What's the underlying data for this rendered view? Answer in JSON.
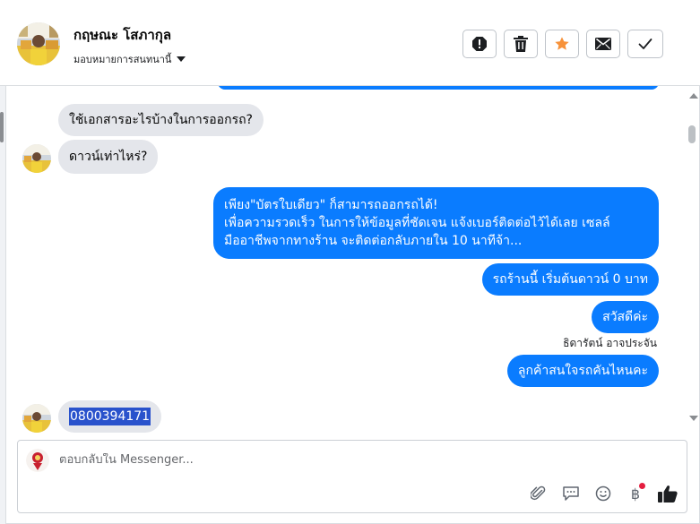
{
  "header": {
    "contact_name": "กฤษณะ โสภากุล",
    "assign_label": "มอบหมายการสนทนานี้",
    "actions": [
      {
        "name": "report-icon"
      },
      {
        "name": "trash-icon"
      },
      {
        "name": "star-icon",
        "color": "#f7923a"
      },
      {
        "name": "envelope-icon"
      },
      {
        "name": "checkmark-icon"
      }
    ]
  },
  "messages": [
    {
      "id": "m1",
      "dir": "in",
      "text": "ใช้เอกสารอะไรบ้างในการออกรถ?"
    },
    {
      "id": "m2",
      "dir": "in",
      "text": "ดาวน์เท่าไหร่?"
    },
    {
      "id": "m3",
      "dir": "out",
      "text": "เพียง\"บัตรใบเดียว\" ก็สามารถออกรถได้!\nเพื่อความรวดเร็ว ในการให้ข้อมูลที่ชัดเจน แจ้งเบอร์ติดต่อไว้ได้เลย เซลล์\nมืออาชีพจากทางร้าน จะติดต่อกลับภายใน 10 นาทีจ้า..."
    },
    {
      "id": "m4",
      "dir": "out",
      "text": "รถร้านนี้ เริ่มต้นดาวน์ 0 บาท"
    },
    {
      "id": "m5",
      "dir": "out",
      "text": "สวัสดีค่ะ"
    },
    {
      "id": "m6",
      "dir": "out",
      "text": "ลูกค้าสนใจรถคันไหนคะ"
    },
    {
      "id": "m7",
      "dir": "in",
      "text": "0800394171"
    }
  ],
  "sender_label": "ธิดารัตน์ อาจประจัน",
  "composer": {
    "placeholder": "ตอบกลับใน Messenger...",
    "value": "",
    "tools": [
      "paperclip-icon",
      "speech-bubble-icon",
      "emoji-icon",
      "baht-icon",
      "thumbs-up-icon"
    ]
  },
  "colors": {
    "outgoing_bubble": "#0a7cff",
    "incoming_bubble": "#e4e6eb",
    "selection_highlight": "#2952cc",
    "notification_dot": "#e41e3f"
  }
}
